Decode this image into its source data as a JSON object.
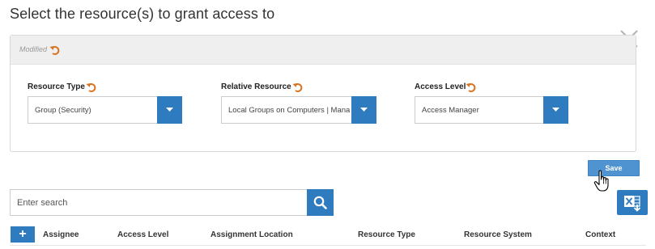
{
  "page": {
    "title": "Select the resource(s) to grant access to"
  },
  "panel": {
    "modified_label": "Modified",
    "fields": [
      {
        "label": "Resource Type",
        "value": "Group (Security)"
      },
      {
        "label": "Relative Resource",
        "value": "Local Groups on Computers | Mana"
      },
      {
        "label": "Access Level",
        "value": "Access Manager"
      }
    ]
  },
  "actions": {
    "save_label": "Save"
  },
  "search": {
    "placeholder": "Enter search"
  },
  "table": {
    "add_label": "+",
    "columns": [
      "Assignee",
      "Access Level",
      "Assignment Location",
      "Resource Type",
      "Resource System",
      "Context"
    ]
  },
  "icons": {
    "undo": "undo-icon",
    "close": "close-icon",
    "dropdown": "chevron-down-icon",
    "search": "search-icon",
    "excel": "excel-export-icon",
    "cursor": "hand-pointer-icon"
  },
  "colors": {
    "accent": "#2f7bbf",
    "save_button": "#4f94d1",
    "undo_orange": "#d9731f",
    "panel_header": "#efefef"
  }
}
